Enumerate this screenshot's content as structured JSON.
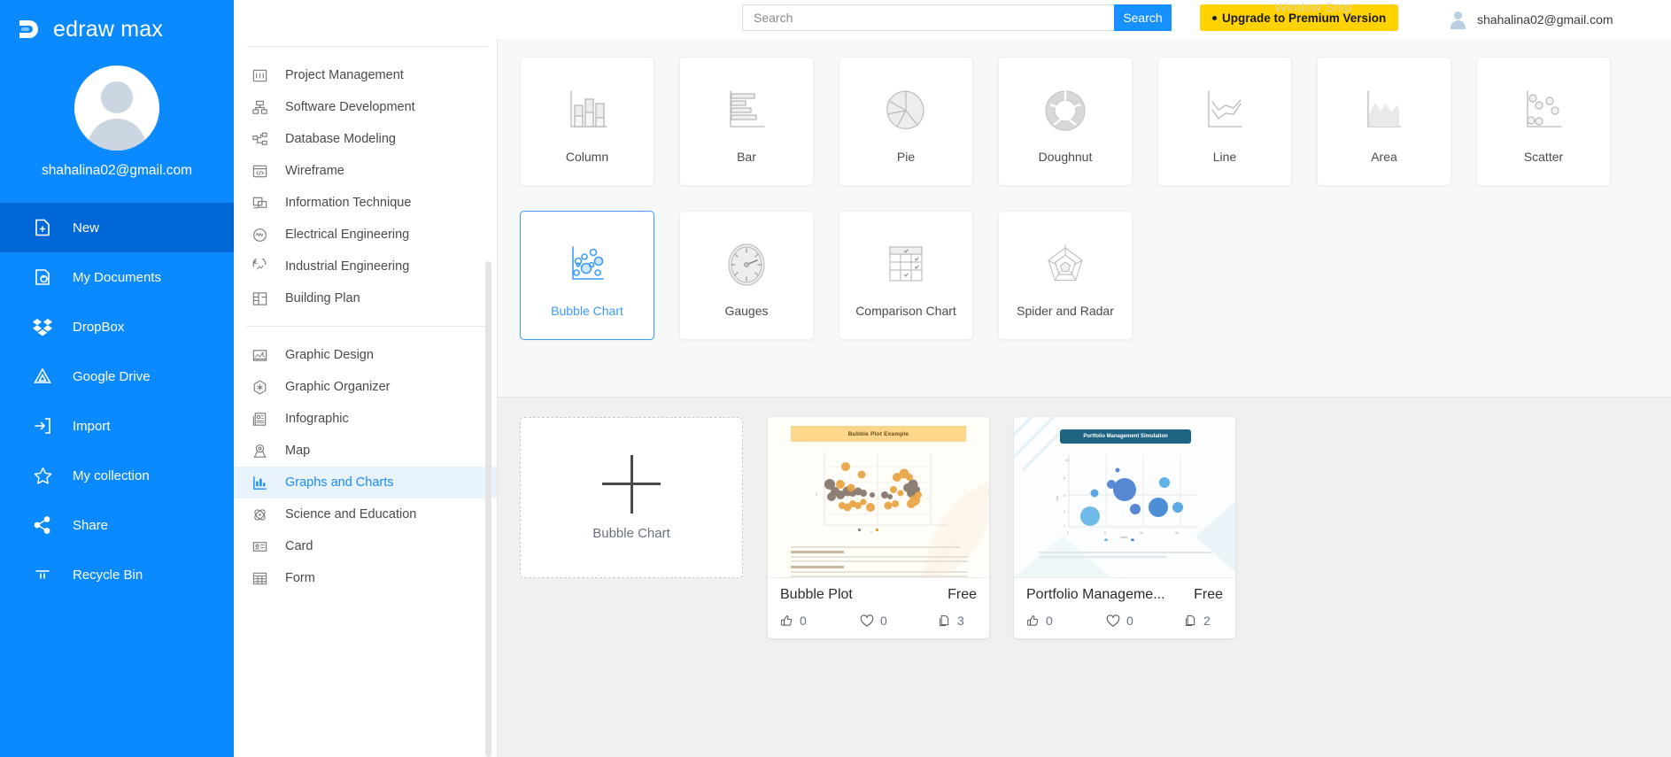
{
  "brand": {
    "name": "edraw max",
    "logo_icon": "edraw-logo-icon"
  },
  "sidebar": {
    "user_email": "shahalina02@gmail.com",
    "avatar_icon": "user-avatar-icon",
    "items": [
      {
        "label": "New",
        "icon": "new-document-icon",
        "active": true
      },
      {
        "label": "My Documents",
        "icon": "my-documents-icon",
        "active": false
      },
      {
        "label": "DropBox",
        "icon": "dropbox-icon",
        "active": false
      },
      {
        "label": "Google Drive",
        "icon": "google-drive-icon",
        "active": false
      },
      {
        "label": "Import",
        "icon": "import-icon",
        "active": false
      },
      {
        "label": "My collection",
        "icon": "star-icon",
        "active": false
      },
      {
        "label": "Share",
        "icon": "share-icon",
        "active": false
      },
      {
        "label": "Recycle Bin",
        "icon": "recycle-bin-icon",
        "active": false
      }
    ]
  },
  "header": {
    "search": {
      "value": "",
      "placeholder": "Search",
      "button_label": "Search",
      "icon": "search-icon"
    },
    "upgrade_label": "Upgrade to Premium Version",
    "user_email": "shahalina02@gmail.com",
    "avatar_icon": "user-avatar-icon",
    "watermark": "Window Snip",
    "accent_blue": "#1890ff",
    "upgrade_yellow": "#ffd200"
  },
  "categories": {
    "group1": [
      {
        "label": "Project Management",
        "icon": "project-management-icon"
      },
      {
        "label": "Software Development",
        "icon": "software-development-icon"
      },
      {
        "label": "Database Modeling",
        "icon": "database-modeling-icon"
      },
      {
        "label": "Wireframe",
        "icon": "wireframe-icon"
      },
      {
        "label": "Information Technique",
        "icon": "information-technique-icon"
      },
      {
        "label": "Electrical Engineering",
        "icon": "electrical-engineering-icon"
      },
      {
        "label": "Industrial Engineering",
        "icon": "industrial-engineering-icon"
      },
      {
        "label": "Building Plan",
        "icon": "building-plan-icon"
      }
    ],
    "group2": [
      {
        "label": "Graphic Design",
        "icon": "graphic-design-icon",
        "active": false
      },
      {
        "label": "Graphic Organizer",
        "icon": "graphic-organizer-icon",
        "active": false
      },
      {
        "label": "Infographic",
        "icon": "infographic-icon",
        "active": false
      },
      {
        "label": "Map",
        "icon": "map-pin-icon",
        "active": false
      },
      {
        "label": "Graphs and Charts",
        "icon": "bar-chart-icon",
        "active": true
      },
      {
        "label": "Science and Education",
        "icon": "atom-icon",
        "active": false
      },
      {
        "label": "Card",
        "icon": "id-card-icon",
        "active": false
      },
      {
        "label": "Form",
        "icon": "grid-table-icon",
        "active": false
      }
    ]
  },
  "chart_types": {
    "row1": [
      {
        "label": "Column",
        "icon": "column-chart-icon",
        "selected": false
      },
      {
        "label": "Bar",
        "icon": "bar-chart-icon",
        "selected": false
      },
      {
        "label": "Pie",
        "icon": "pie-chart-icon",
        "selected": false
      },
      {
        "label": "Doughnut",
        "icon": "doughnut-chart-icon",
        "selected": false
      },
      {
        "label": "Line",
        "icon": "line-chart-icon",
        "selected": false
      },
      {
        "label": "Area",
        "icon": "area-chart-icon",
        "selected": false
      },
      {
        "label": "Scatter",
        "icon": "scatter-chart-icon",
        "selected": false
      }
    ],
    "row2": [
      {
        "label": "Bubble Chart",
        "icon": "bubble-chart-icon",
        "selected": true
      },
      {
        "label": "Gauges",
        "icon": "gauge-icon",
        "selected": false
      },
      {
        "label": "Comparison Chart",
        "icon": "comparison-chart-icon",
        "selected": false
      },
      {
        "label": "Spider and Radar",
        "icon": "spider-radar-icon",
        "selected": false
      }
    ]
  },
  "templates": {
    "new_card": {
      "label": "Bubble Chart",
      "icon": "plus-icon"
    },
    "items": [
      {
        "title": "Bubble Plot",
        "price": "Free",
        "likes": "0",
        "favorites": "0",
        "copies": "3",
        "thumb_title": "Bubble Plot Example",
        "like_icon": "thumbs-up-icon",
        "favorite_icon": "heart-icon",
        "copy_icon": "copy-icon"
      },
      {
        "title": "Portfolio Manageme...",
        "price": "Free",
        "likes": "0",
        "favorites": "0",
        "copies": "2",
        "thumb_title": "Portfolio Management Simulation",
        "like_icon": "thumbs-up-icon",
        "favorite_icon": "heart-icon",
        "copy_icon": "copy-icon"
      }
    ]
  }
}
